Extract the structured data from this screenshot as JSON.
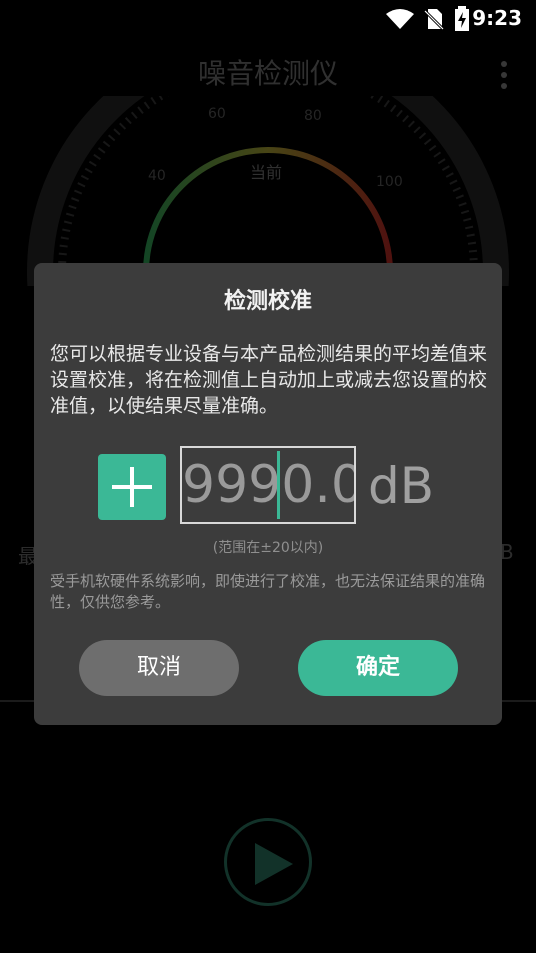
{
  "status_bar": {
    "time": "9:23",
    "icons": [
      "wifi-icon",
      "no-sim-icon",
      "battery-charging-icon"
    ]
  },
  "app": {
    "title": "噪音检测仪",
    "gauge": {
      "label": "当前",
      "ticks": [
        "40",
        "60",
        "80",
        "100"
      ]
    },
    "side_left_text": "最",
    "side_right_text": "B",
    "colors": {
      "accent": "#3bb896",
      "gauge_start": "#2e9a4e",
      "gauge_end": "#c0201e"
    }
  },
  "dialog": {
    "title": "检测校准",
    "description": "您可以根据专业设备与本产品检测结果的平均差值来设置校准，将在检测值上自动加上或减去您设置的校准值，以使结果尽量准确。",
    "value": "9990.0",
    "unit": "dB",
    "range_hint": "(范围在±20以内)",
    "note": "受手机软硬件系统影响，即使进行了校准，也无法保证结果的准确性，仅供您参考。",
    "cancel_label": "取消",
    "confirm_label": "确定"
  }
}
